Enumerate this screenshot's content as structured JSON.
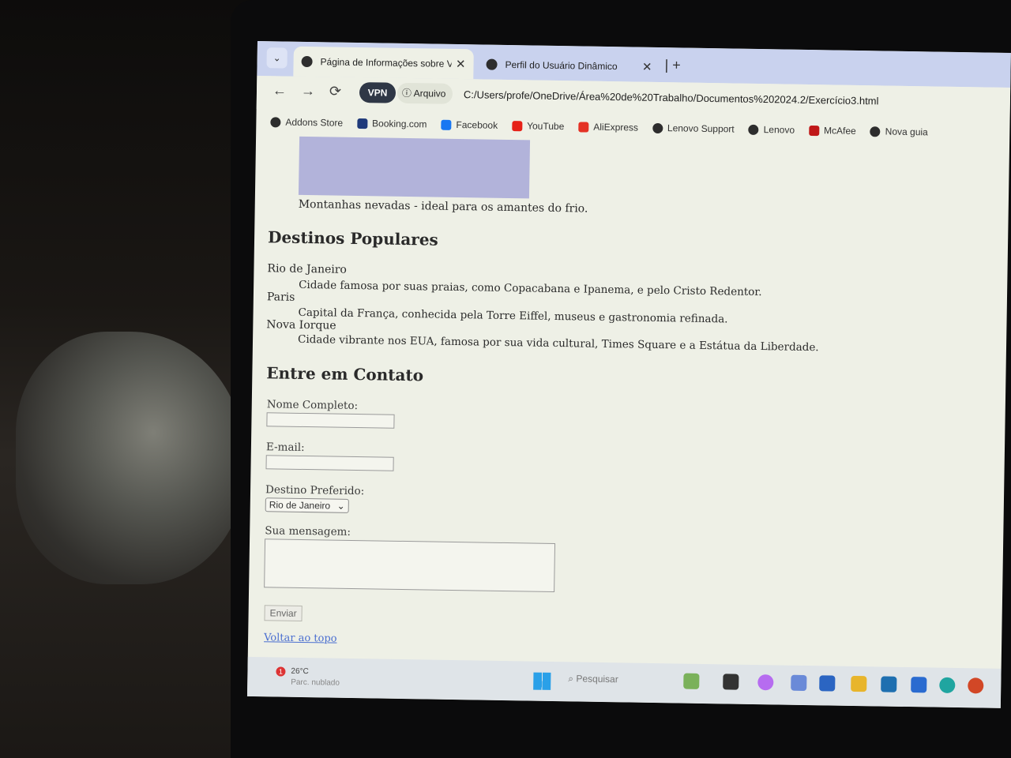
{
  "tabs": [
    {
      "title": "Página de Informações sobre Vi",
      "active": true
    },
    {
      "title": "Perfil do Usuário Dinâmico",
      "active": false
    }
  ],
  "toolbar": {
    "vpn_label": "VPN",
    "scheme_label": "Arquivo",
    "url": "C:/Users/profe/OneDrive/Área%20de%20Trabalho/Documentos%202024.2/Exercício3.html"
  },
  "bookmarks": [
    {
      "label": "Addons Store",
      "color": "#2d2d2d"
    },
    {
      "label": "Booking.com",
      "color": "#1f3a7a"
    },
    {
      "label": "Facebook",
      "color": "#1877f2"
    },
    {
      "label": "YouTube",
      "color": "#e62117"
    },
    {
      "label": "AliExpress",
      "color": "#e43225"
    },
    {
      "label": "Lenovo Support",
      "color": "#2d2d2d"
    },
    {
      "label": "Lenovo",
      "color": "#2d2d2d"
    },
    {
      "label": "McAfee",
      "color": "#c01818"
    },
    {
      "label": "Nova guia",
      "color": "#2d2d2d"
    }
  ],
  "page": {
    "image_caption": "Montanhas nevadas - ideal para os amantes do frio.",
    "destinations_heading": "Destinos Populares",
    "destinations": [
      {
        "name": "Rio de Janeiro",
        "desc": "Cidade famosa por suas praias, como Copacabana e Ipanema, e pelo Cristo Redentor."
      },
      {
        "name": "Paris",
        "desc": "Capital da França, conhecida pela Torre Eiffel, museus e gastronomia refinada."
      },
      {
        "name": "Nova Iorque",
        "desc": "Cidade vibrante nos EUA, famosa por sua vida cultural, Times Square e a Estátua da Liberdade."
      }
    ],
    "contact_heading": "Entre em Contato",
    "form": {
      "name_label": "Nome Completo:",
      "name_value": "",
      "email_label": "E-mail:",
      "email_value": "",
      "destination_label": "Destino Preferido:",
      "destination_selected": "Rio de Janeiro",
      "message_label": "Sua mensagem:",
      "message_value": "",
      "submit_label": "Enviar"
    },
    "back_to_top": "Voltar ao topo"
  },
  "taskbar": {
    "temperature": "26°C",
    "condition": "Parc. nublado",
    "search_placeholder": "Pesquisar",
    "weather_badge": "1"
  }
}
